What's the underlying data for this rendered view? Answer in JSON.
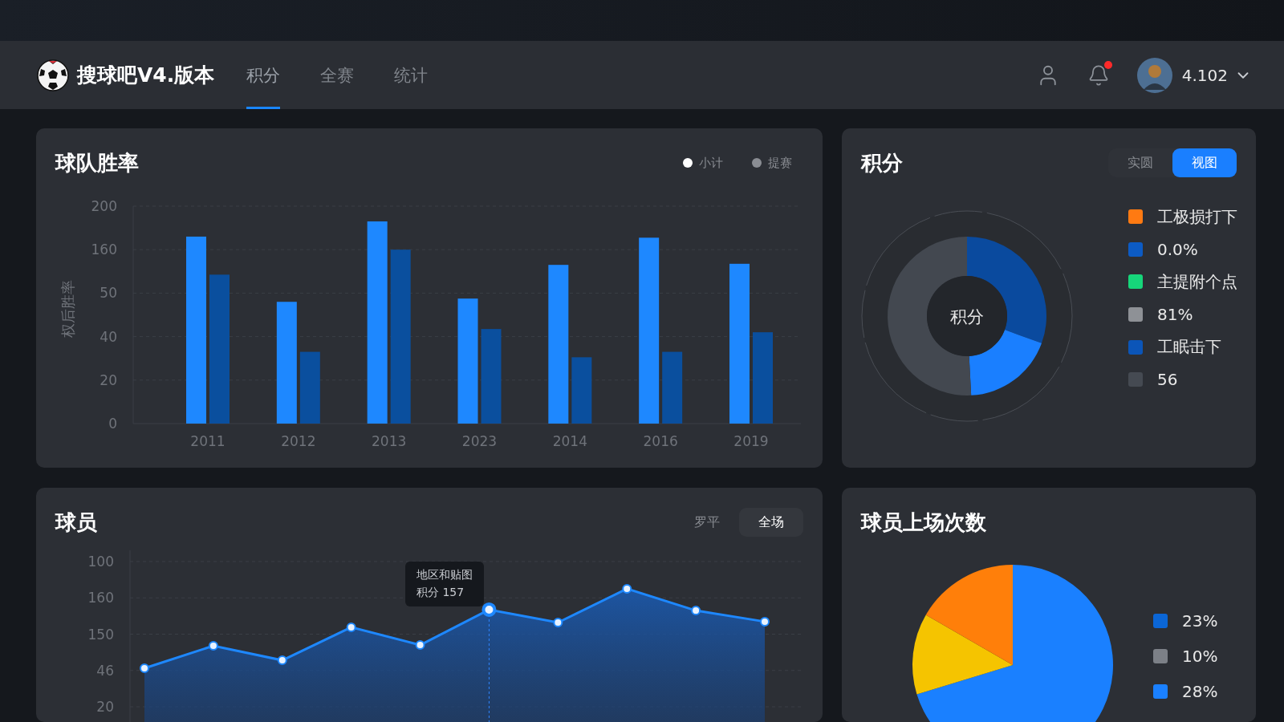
{
  "header": {
    "logo_text": "搜球吧V4.版本",
    "tabs": [
      {
        "label": "积分",
        "selected": true
      },
      {
        "label": "全赛",
        "selected": false
      },
      {
        "label": "统计",
        "selected": false
      }
    ],
    "has_notification": true,
    "user": {
      "name": "4.102"
    }
  },
  "win_rate_card": {
    "title": "球队胜率",
    "legend": [
      {
        "label": "小计",
        "color": "#ffffff"
      },
      {
        "label": "提赛",
        "color": "#8a8d93"
      }
    ],
    "y_axis_title": "权后胜率",
    "y_axis_labels": [
      "200",
      "160",
      "50",
      "40",
      "20",
      "0"
    ],
    "x_axis_labels": [
      "2011",
      "2012",
      "2013",
      "2023",
      "2014",
      "2016",
      "2019"
    ]
  },
  "points_card": {
    "title": "积分",
    "toggle": [
      {
        "label": "实圆",
        "selected": false
      },
      {
        "label": "视图",
        "selected": true
      }
    ],
    "donut_center": "积分",
    "legend": [
      {
        "text": "工极损打下",
        "color": "#ff7a12"
      },
      {
        "text": "0.0%",
        "color": "#0c5bc4"
      },
      {
        "text": "主提附个点",
        "color": "#16d67a"
      },
      {
        "text": "81%",
        "color": "#8e9196"
      },
      {
        "text": "工眠击下",
        "color": "#0b55b8"
      },
      {
        "text": "56",
        "color": "#454a52"
      }
    ]
  },
  "players_card": {
    "title": "球员",
    "toggle": [
      {
        "label": "罗平",
        "selected": false
      },
      {
        "label": "全场",
        "selected": true
      }
    ],
    "y_axis_labels": [
      "100",
      "160",
      "150",
      "46",
      "20"
    ],
    "tooltip": [
      "地区和贴图",
      "积分 157"
    ]
  },
  "appearances_card": {
    "title": "球员上场次数",
    "legend": [
      {
        "text": "23%",
        "color": "#0b66d6"
      },
      {
        "text": "10%",
        "color": "#7c8087"
      },
      {
        "text": "28%",
        "color": "#1a80ff"
      }
    ]
  }
}
